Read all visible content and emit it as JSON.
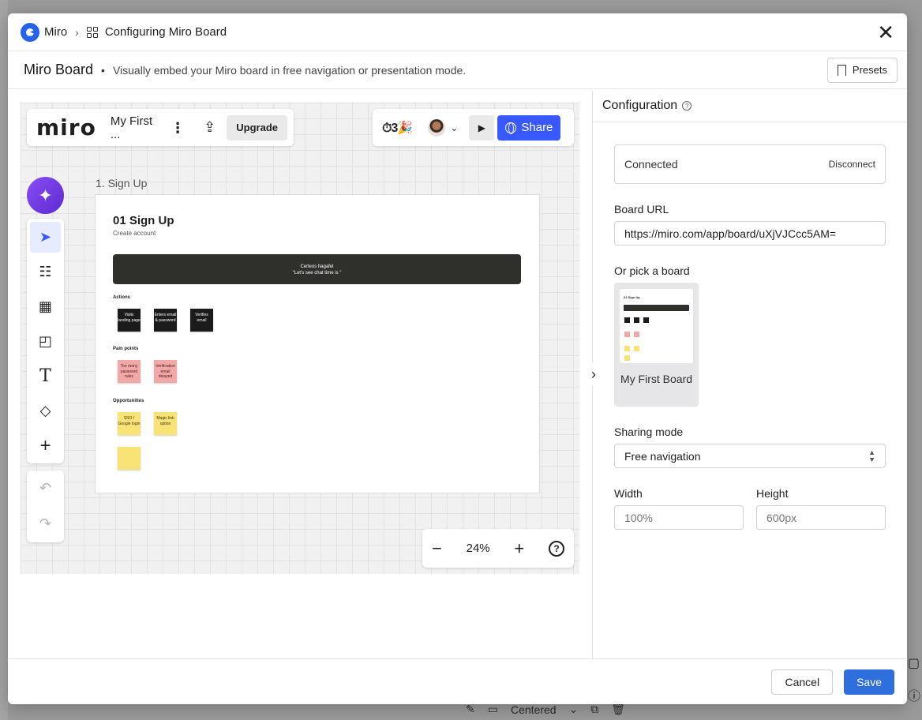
{
  "background": {
    "bottom_toolbar": {
      "alignment": "Centered"
    }
  },
  "header": {
    "app_name": "Miro",
    "breadcrumb_current": "Configuring Miro Board"
  },
  "subheader": {
    "title": "Miro Board",
    "description": "Visually embed your Miro board in free navigation or presentation mode.",
    "presets_label": "Presets"
  },
  "preview": {
    "miro_logo": "miro",
    "board_name": "My First ...",
    "upgrade_label": "Upgrade",
    "share_label": "Share",
    "reactions": "⏱3🎉",
    "frame_label": "1. Sign Up",
    "frame": {
      "title": "01 Sign Up",
      "subtitle": "Create account",
      "banner_line1": "Cerleos hagafel",
      "banner_line2": "\"Let's see chat time is \"",
      "sections": [
        "Actions",
        "Pain points",
        "Opportunities"
      ],
      "action_notes": [
        "Visits landing page",
        "Enters email & password",
        "Verifies email"
      ],
      "pain_notes": [
        "Too many password rules",
        "Verification email delayed"
      ],
      "opportunity_notes": [
        "SSO / Google login",
        "Magic link option",
        ""
      ]
    },
    "zoom_level": "24%"
  },
  "config": {
    "title": "Configuration",
    "connected_label": "Connected",
    "disconnect_label": "Disconnect",
    "board_url_label": "Board URL",
    "board_url_value": "https://miro.com/app/board/uXjVJCcc5AM=",
    "pick_board_label": "Or pick a board",
    "picked_board_name": "My First Board",
    "thumb_title": "01 Sign Up",
    "sharing_mode_label": "Sharing mode",
    "sharing_mode_value": "Free navigation",
    "width_label": "Width",
    "width_placeholder": "100%",
    "height_label": "Height",
    "height_placeholder": "600px"
  },
  "footer": {
    "cancel_label": "Cancel",
    "save_label": "Save"
  },
  "colors": {
    "primary": "#2f6fdd",
    "miro_share": "#3859ff",
    "ai_button": "#7a3ff0"
  }
}
